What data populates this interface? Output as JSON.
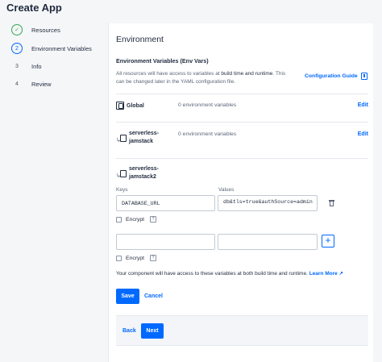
{
  "app": {
    "title": "Create App"
  },
  "steps": [
    {
      "marker": "✓",
      "label": "Resources",
      "state": "done"
    },
    {
      "marker": "2",
      "label": "Environment Variables",
      "state": "active"
    },
    {
      "marker": "3",
      "label": "Info",
      "state": "pending"
    },
    {
      "marker": "4",
      "label": "Review",
      "state": "pending"
    }
  ],
  "main": {
    "heading": "Environment",
    "section_title": "Environment Variables (Env Vars)",
    "description_pre": "All resources will have access to variables at ",
    "description_bold": "build time and runtime",
    "description_post": ". This can be changed later in the YAML configuration file.",
    "config_link": "Configuration Guide"
  },
  "components": {
    "global": {
      "name": "Global",
      "count": "0 environment variables",
      "edit": "Edit"
    },
    "service1": {
      "arrow": "↳",
      "name": "serverless-jamstack",
      "count": "0 environment variables",
      "edit": "Edit"
    },
    "service2": {
      "arrow": "↳",
      "name": "serverless-jamstack2"
    }
  },
  "env_form": {
    "keys_label": "Keys",
    "values_label": "Values",
    "rows": [
      {
        "key": "DATABASE_URL",
        "value": "db&tls=true&authSource=admin",
        "encrypt_label": "Encrypt",
        "help": "?"
      }
    ],
    "new_row": {
      "key": "",
      "value": "",
      "encrypt_label": "Encrypt",
      "help": "?"
    },
    "add_label": "+",
    "note": "Your component will have access to these variables at both build time and runtime.",
    "learn_more": "Learn More ↗",
    "save": "Save",
    "cancel": "Cancel"
  },
  "nav": {
    "back": "Back",
    "next": "Next"
  },
  "colors": {
    "accent": "#0069ff",
    "done": "#34a853",
    "text": "#1f2a3d",
    "muted": "#5b6678"
  }
}
